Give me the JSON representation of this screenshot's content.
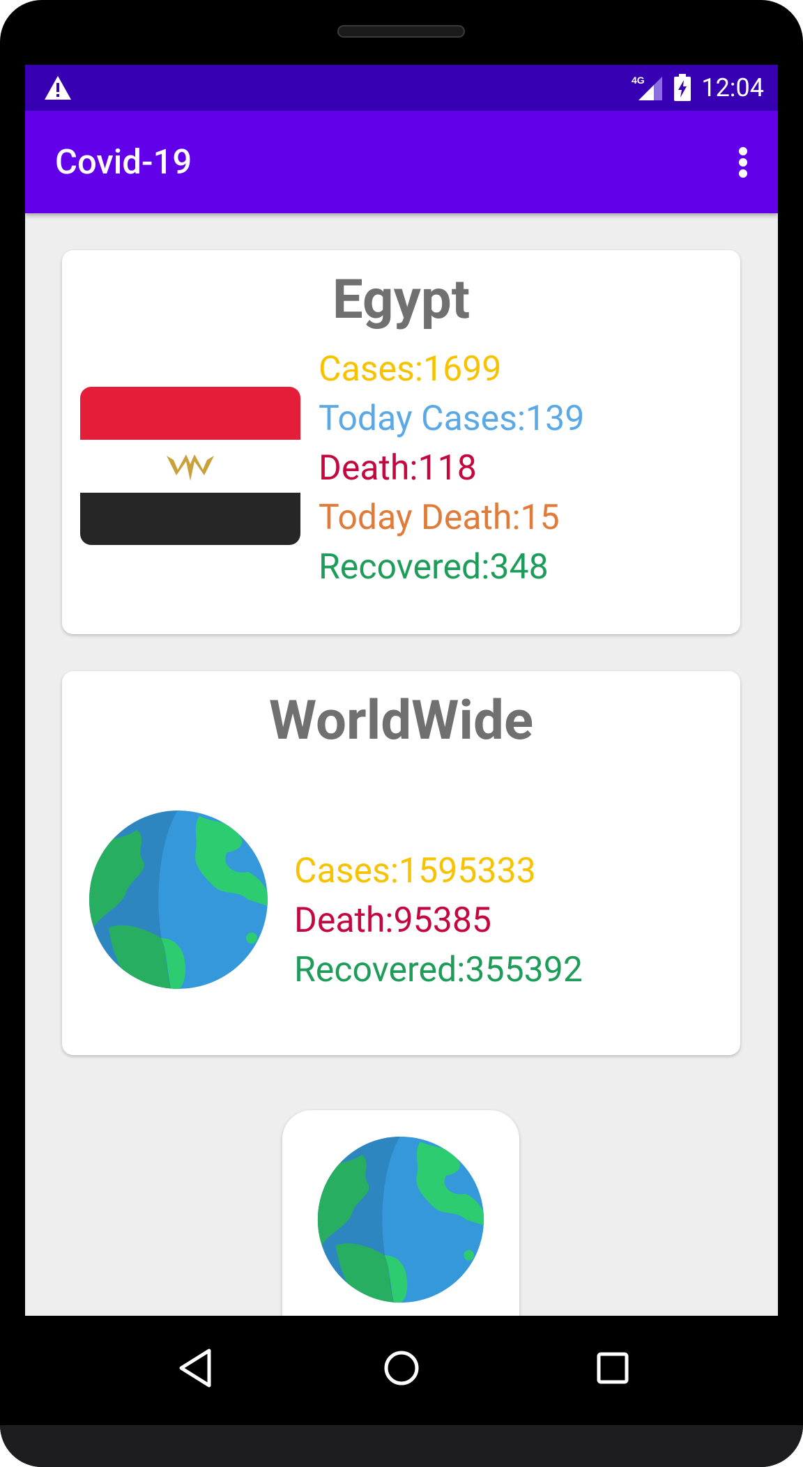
{
  "status_bar": {
    "time": "12:04",
    "network": "4G",
    "icons": [
      "warning-icon",
      "signal-icon",
      "battery-charging-icon"
    ]
  },
  "app_bar": {
    "title": "Covid-19",
    "menu_icon": "overflow-menu-icon"
  },
  "country_card": {
    "title": "Egypt",
    "flag": "egypt-flag",
    "stats": {
      "cases": "Cases:1699",
      "today_cases": "Today Cases:139",
      "death": "Death:118",
      "today_death": "Today Death:15",
      "recovered": "Recovered:348"
    }
  },
  "world_card": {
    "title": "WorldWide",
    "icon": "globe-icon",
    "stats": {
      "cases": "Cases:1595333",
      "death": "Death:95385",
      "recovered": "Recovered:355392"
    }
  },
  "bottom_card": {
    "icon": "globe-icon"
  },
  "nav_bar": {
    "buttons": [
      "back-icon",
      "home-icon",
      "recents-icon"
    ]
  },
  "colors": {
    "status_bar": "#3700b3",
    "app_bar": "#6200ea",
    "cases": "#f7c200",
    "today_cases": "#5aa9e6",
    "death": "#c4073f",
    "today_death": "#e07b39",
    "recovered": "#1e9c5a",
    "title_gray": "#707070"
  }
}
